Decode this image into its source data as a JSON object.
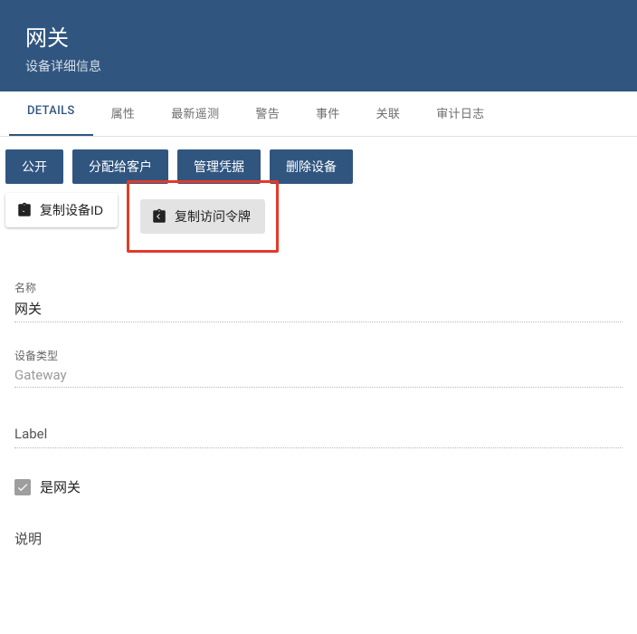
{
  "header": {
    "title": "网关",
    "subtitle": "设备详细信息"
  },
  "tabs": [
    {
      "label": "DETAILS",
      "active": true
    },
    {
      "label": "属性",
      "active": false
    },
    {
      "label": "最新遥测",
      "active": false
    },
    {
      "label": "警告",
      "active": false
    },
    {
      "label": "事件",
      "active": false
    },
    {
      "label": "关联",
      "active": false
    },
    {
      "label": "审计日志",
      "active": false
    }
  ],
  "actions": {
    "publish": "公开",
    "assign_customer": "分配给客户",
    "manage_credentials": "管理凭据",
    "delete_device": "删除设备",
    "copy_device_id": "复制设备ID",
    "copy_access_token": "复制访问令牌"
  },
  "fields": {
    "name_label": "名称",
    "name_value": "网关",
    "type_label": "设备类型",
    "type_value": "Gateway",
    "label_label": "Label",
    "label_value": "",
    "is_gateway_label": "是网关",
    "is_gateway_checked": true,
    "description_label": "说明",
    "description_value": ""
  }
}
